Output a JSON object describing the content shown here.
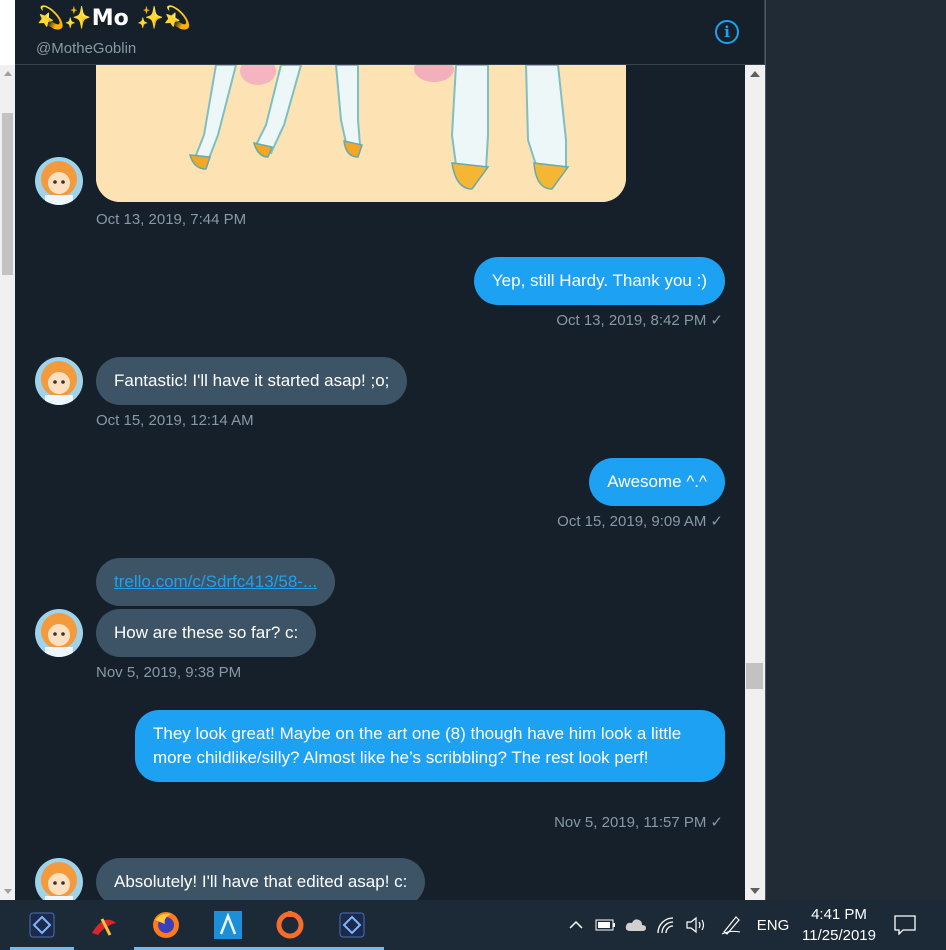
{
  "header": {
    "display_name": "💫✨Mo ✨💫",
    "handle": "@MotheGoblin",
    "info_glyph": "i"
  },
  "messages": [
    {
      "id": "m1",
      "side": "in",
      "kind": "image",
      "timestamp": "Oct 13, 2019, 7:44 PM"
    },
    {
      "id": "m2",
      "side": "out",
      "text": "Yep, still Hardy. Thank you :)",
      "timestamp": "Oct 13, 2019, 8:42 PM"
    },
    {
      "id": "m3",
      "side": "in",
      "text": "Fantastic! I'll have it started asap! ;o;",
      "timestamp": "Oct 15, 2019, 12:14 AM"
    },
    {
      "id": "m4",
      "side": "out",
      "text": "Awesome ^.^",
      "timestamp": "Oct 15, 2019, 9:09 AM"
    },
    {
      "id": "m5",
      "side": "in",
      "link": "trello.com/c/Sdrfc413/58-...",
      "text": "How are these so far? c:",
      "timestamp": "Nov 5, 2019, 9:38 PM"
    },
    {
      "id": "m6",
      "side": "out",
      "text": "They look great! Maybe on the art one (8) though have him look a little more childlike/silly? Almost like he’s scribbling? The rest look perf!",
      "timestamp": "Nov 5, 2019, 11:57 PM"
    },
    {
      "id": "m7",
      "side": "in",
      "text": "Absolutely! I'll have that edited asap! c:"
    }
  ],
  "sent_check": "✓",
  "taskbar": {
    "apps": [
      "app-1",
      "app-2",
      "firefox",
      "affinity",
      "origin",
      "app-6"
    ],
    "language": "ENG",
    "time": "4:41 PM",
    "date": "11/25/2019"
  },
  "colors": {
    "background": "#15202b",
    "incoming_bubble": "#3d5466",
    "outgoing_bubble": "#1da1f2",
    "muted_text": "#8899a6"
  }
}
